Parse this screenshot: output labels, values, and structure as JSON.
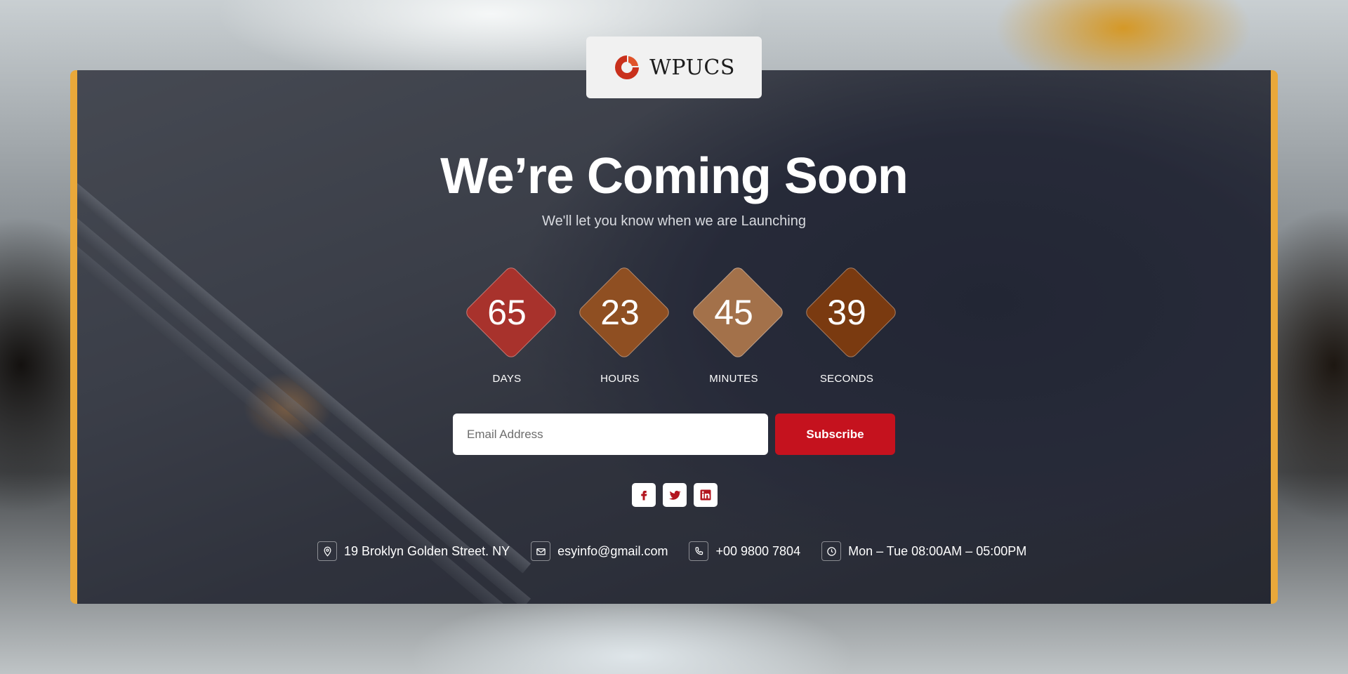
{
  "brand": {
    "name": "WPUCS",
    "logo_icon": "wpucs-logo-icon"
  },
  "hero": {
    "title": "We’re Coming Soon",
    "subtitle": "We'll let you know when we are Launching"
  },
  "countdown": {
    "units": [
      {
        "value": "65",
        "label": "DAYS",
        "color": "#a8322c"
      },
      {
        "value": "23",
        "label": "HOURS",
        "color": "#8f4f22"
      },
      {
        "value": "45",
        "label": "MINUTES",
        "color": "#a3714a"
      },
      {
        "value": "39",
        "label": "SECONDS",
        "color": "#7a3a10"
      }
    ]
  },
  "subscribe": {
    "placeholder": "Email Address",
    "value": "",
    "button_label": "Subscribe",
    "button_color": "#c5121e"
  },
  "socials": [
    {
      "icon": "facebook-icon"
    },
    {
      "icon": "twitter-icon"
    },
    {
      "icon": "linkedin-icon"
    }
  ],
  "contact": {
    "address": "19 Broklyn Golden Street. NY",
    "email": "esyinfo@gmail.com",
    "phone": "+00 9800 7804",
    "hours": "Mon – Tue 08:00AM – 05:00PM"
  },
  "colors": {
    "accent": "#e9a83a",
    "brand_red": "#c5121e"
  }
}
